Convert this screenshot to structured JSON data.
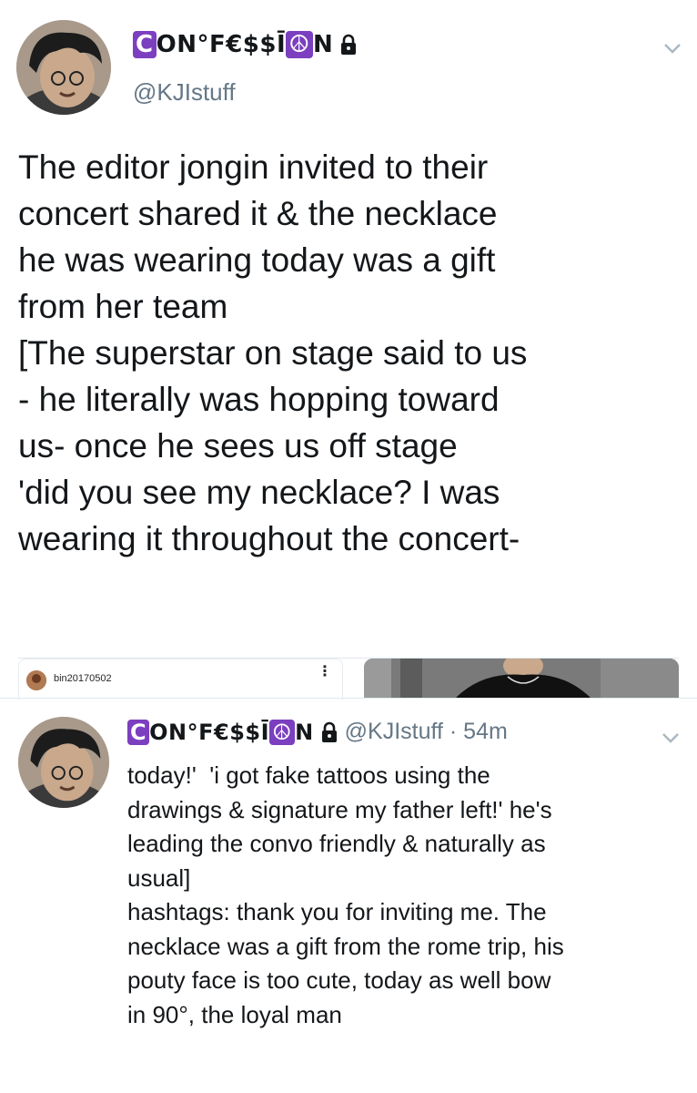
{
  "tweets": [
    {
      "display_name": "CON°F€$$ĪON",
      "display_name_parts": {
        "first_glyph": "C",
        "middle": "ON°F€$$Ī",
        "emoji_glyph": "☮",
        "last": "N"
      },
      "handle": "@KJIstuff",
      "body": "The editor jongin invited to their\nconcert shared it & the necklace\nhe was wearing today was a gift\nfrom her team\n[The superstar on stage said to us\n- he literally was hopping toward\nus- once he sees us off stage\n'did you see my necklace? I was\nwearing it throughout the concert-",
      "icons": [
        "avatar",
        "lock-icon",
        "chevron-down-icon"
      ],
      "embed": {
        "username": "bin20170502",
        "more_icon": "more-vertical-icon"
      }
    },
    {
      "display_name": "CON°F€$$ĪON",
      "display_name_parts": {
        "first_glyph": "C",
        "middle": "ON°F€$$Ī",
        "emoji_glyph": "☮",
        "last": "N"
      },
      "handle_time": "@KJIstuff · 54m",
      "body": "today!'  'i got fake tattoos using the\ndrawings & signature my father left!' he's\nleading the convo friendly & naturally as\nusual]\nhashtags: thank you for inviting me. The\nnecklace was a gift from the rome trip, his\npouty face is too cute, today as well bow\nin 90°, the loyal man",
      "icons": [
        "avatar",
        "lock-icon",
        "chevron-down-icon"
      ]
    }
  ],
  "colors": {
    "text": "#14171a",
    "muted": "#657786",
    "divider": "#e1e8ed",
    "emoji_bg": "#7b3fbf"
  }
}
